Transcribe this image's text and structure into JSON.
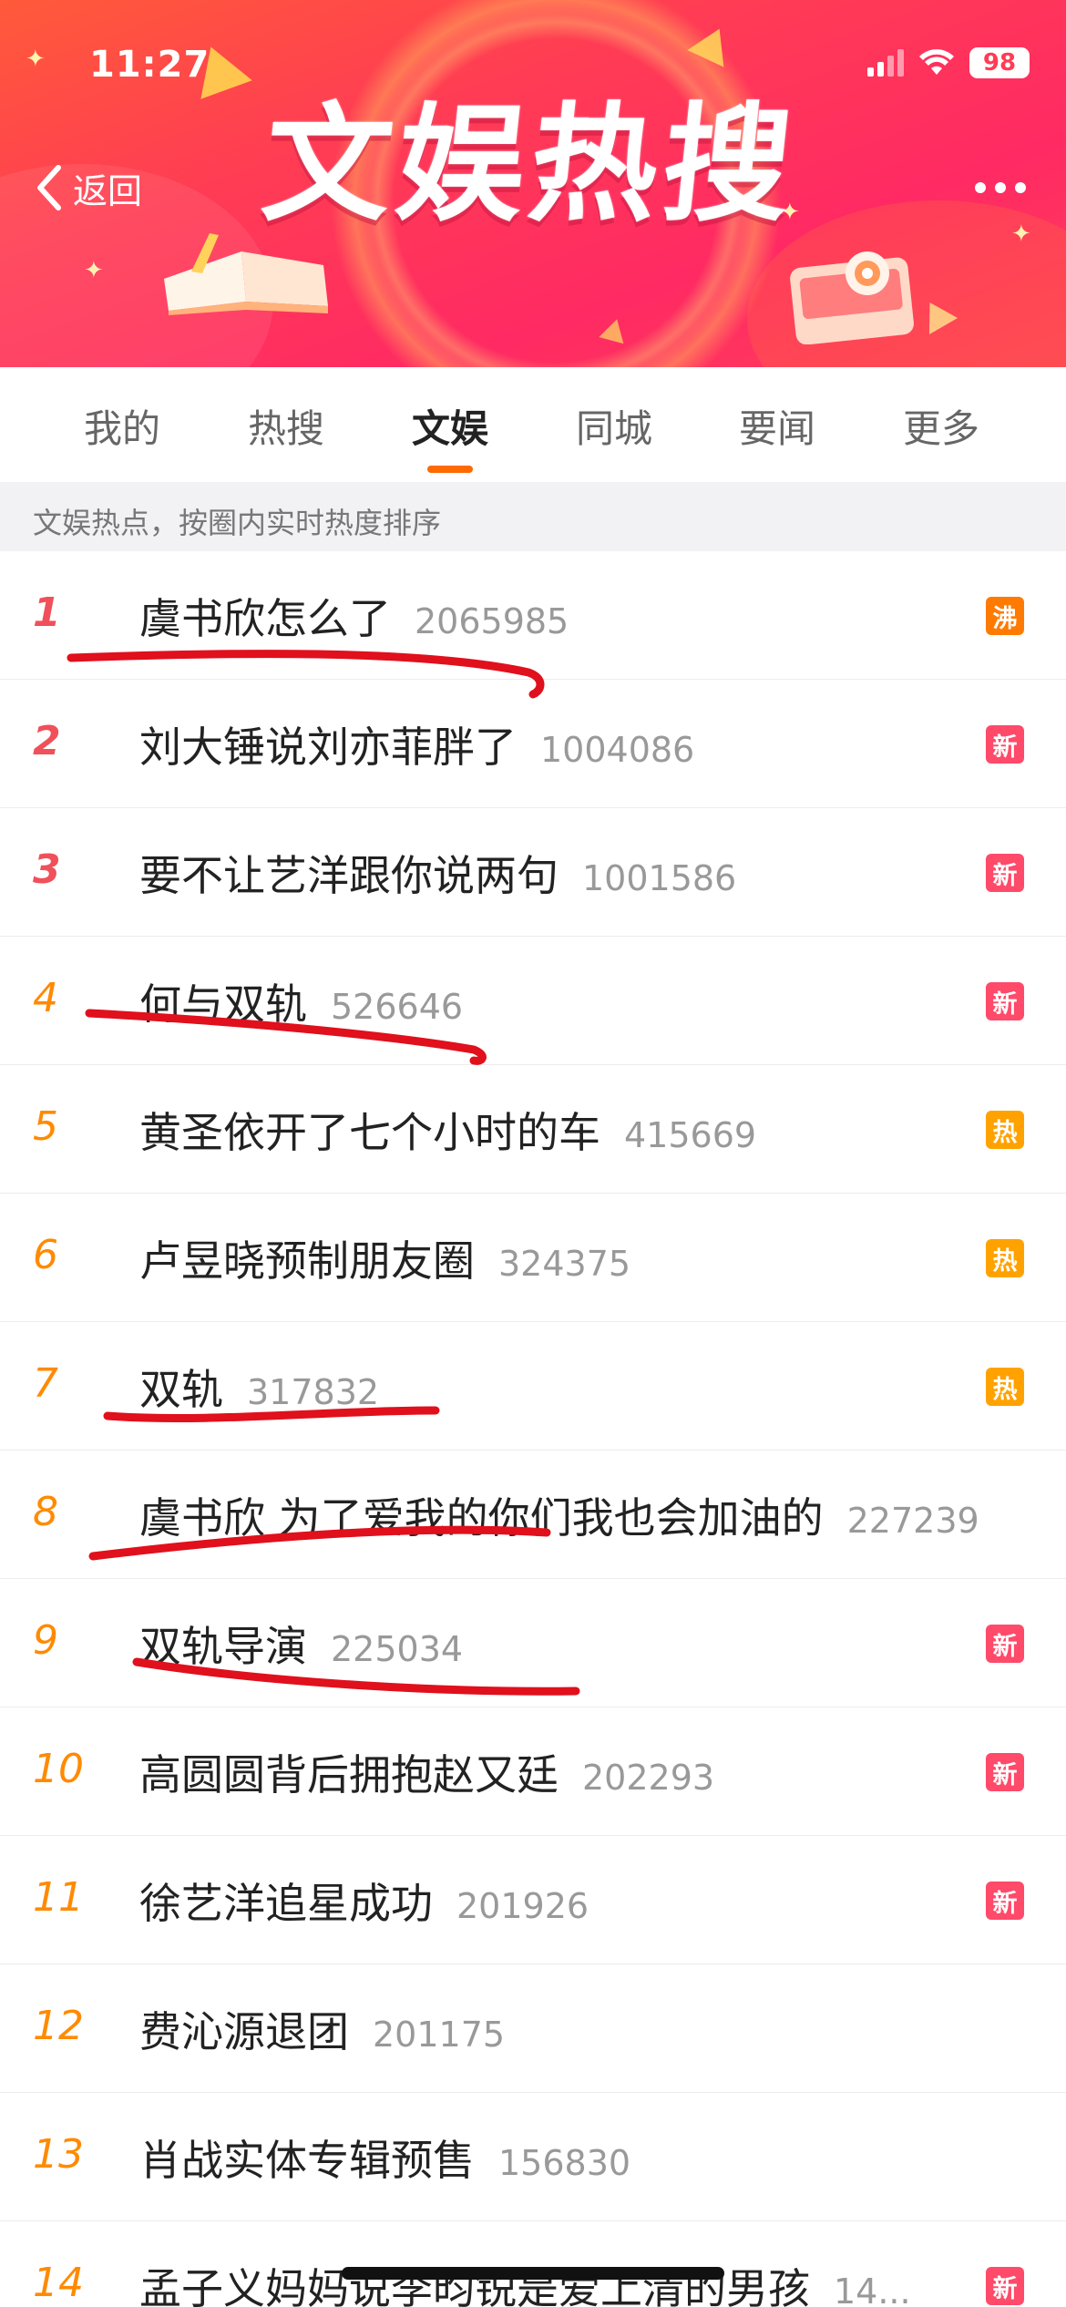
{
  "status_bar": {
    "time": "11:27",
    "battery": "98"
  },
  "header": {
    "back_label": "返回",
    "banner_title": "文娱热搜"
  },
  "tabs": [
    {
      "label": "我的",
      "active": false
    },
    {
      "label": "热搜",
      "active": false
    },
    {
      "label": "文娱",
      "active": true
    },
    {
      "label": "同城",
      "active": false
    },
    {
      "label": "要闻",
      "active": false
    },
    {
      "label": "更多",
      "active": false
    }
  ],
  "subheader": "文娱热点，按圈内实时热度排序",
  "colors": {
    "accent": "#ff6a00",
    "badge_hot": "#ffa200",
    "badge_new": "#ff4a6a",
    "badge_boil": "#ff7a00",
    "annotation_red": "#e0101c"
  },
  "list": [
    {
      "rank": "1",
      "title": "虞书欣怎么了",
      "count": "2065985",
      "badge": "沸",
      "badge_type": "boil"
    },
    {
      "rank": "2",
      "title": "刘大锤说刘亦菲胖了",
      "count": "1004086",
      "badge": "新",
      "badge_type": "new"
    },
    {
      "rank": "3",
      "title": "要不让艺洋跟你说两句",
      "count": "1001586",
      "badge": "新",
      "badge_type": "new"
    },
    {
      "rank": "4",
      "title": "何与双轨",
      "count": "526646",
      "badge": "新",
      "badge_type": "new"
    },
    {
      "rank": "5",
      "title": "黄圣依开了七个小时的车",
      "count": "415669",
      "badge": "热",
      "badge_type": "hot"
    },
    {
      "rank": "6",
      "title": "卢昱晓预制朋友圈",
      "count": "324375",
      "badge": "热",
      "badge_type": "hot"
    },
    {
      "rank": "7",
      "title": "双轨",
      "count": "317832",
      "badge": "热",
      "badge_type": "hot"
    },
    {
      "rank": "8",
      "title": "虞书欣 为了爱我的你们我也会加油的",
      "count": "227239",
      "badge": "",
      "badge_type": ""
    },
    {
      "rank": "9",
      "title": "双轨导演",
      "count": "225034",
      "badge": "新",
      "badge_type": "new"
    },
    {
      "rank": "10",
      "title": "高圆圆背后拥抱赵又廷",
      "count": "202293",
      "badge": "新",
      "badge_type": "new"
    },
    {
      "rank": "11",
      "title": "徐艺洋追星成功",
      "count": "201926",
      "badge": "新",
      "badge_type": "new"
    },
    {
      "rank": "12",
      "title": "费沁源退团",
      "count": "201175",
      "badge": "",
      "badge_type": ""
    },
    {
      "rank": "13",
      "title": "肖战实体专辑预售",
      "count": "156830",
      "badge": "",
      "badge_type": ""
    },
    {
      "rank": "14",
      "title": "孟子义妈妈说李昀锐是爱上清的男孩",
      "count": "14...",
      "badge": "新",
      "badge_type": "new"
    }
  ]
}
